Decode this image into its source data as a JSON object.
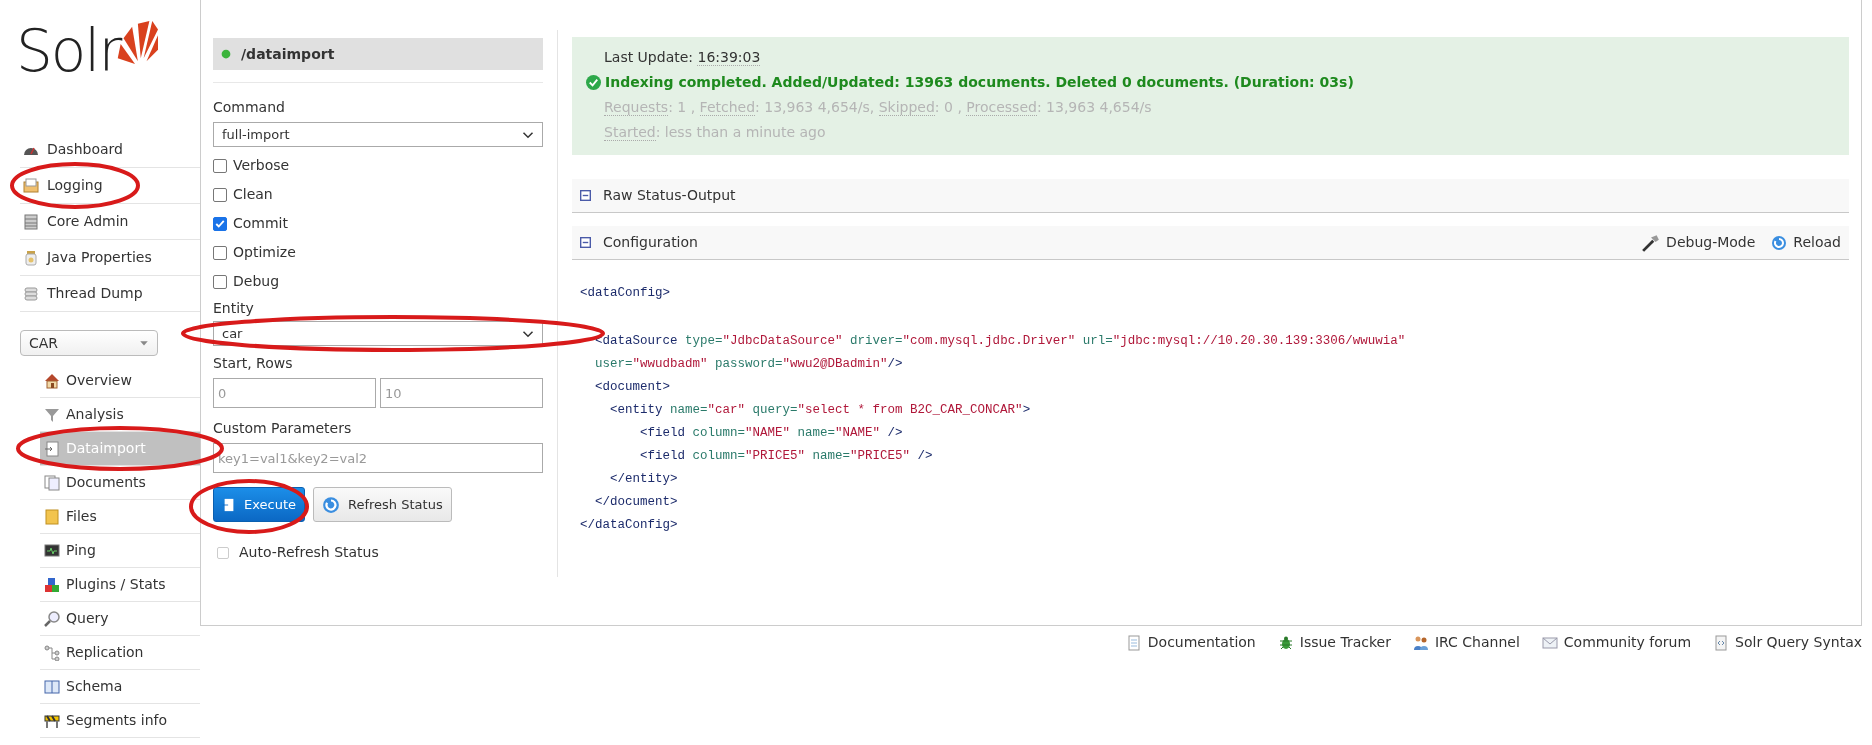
{
  "logo": {
    "text": "Solr"
  },
  "nav": [
    {
      "label": "Dashboard",
      "annotated": false
    },
    {
      "label": "Logging",
      "annotated": true
    },
    {
      "label": "Core Admin",
      "annotated": false
    },
    {
      "label": "Java Properties",
      "annotated": false
    },
    {
      "label": "Thread Dump",
      "annotated": false
    }
  ],
  "core_selector": {
    "value": "CAR"
  },
  "core_nav": [
    {
      "label": "Overview",
      "selected": false,
      "annotated": false
    },
    {
      "label": "Analysis",
      "selected": false,
      "annotated": false
    },
    {
      "label": "Dataimport",
      "selected": true,
      "annotated": true
    },
    {
      "label": "Documents",
      "selected": false,
      "annotated": false
    },
    {
      "label": "Files",
      "selected": false,
      "annotated": false
    },
    {
      "label": "Ping",
      "selected": false,
      "annotated": false
    },
    {
      "label": "Plugins / Stats",
      "selected": false,
      "annotated": false
    },
    {
      "label": "Query",
      "selected": false,
      "annotated": false
    },
    {
      "label": "Replication",
      "selected": false,
      "annotated": false
    },
    {
      "label": "Schema",
      "selected": false,
      "annotated": false
    },
    {
      "label": "Segments info",
      "selected": false,
      "annotated": false
    }
  ],
  "form": {
    "handler": "/dataimport",
    "command_label": "Command",
    "command": "full-import",
    "options": [
      {
        "label": "Verbose",
        "checked": false
      },
      {
        "label": "Clean",
        "checked": false
      },
      {
        "label": "Commit",
        "checked": true
      },
      {
        "label": "Optimize",
        "checked": false
      },
      {
        "label": "Debug",
        "checked": false
      }
    ],
    "entity_label": "Entity",
    "entity": "car",
    "entity_annotated": true,
    "start_rows_label": "Start, Rows",
    "start_placeholder": "0",
    "rows_placeholder": "10",
    "custom_label": "Custom Parameters",
    "custom_placeholder": "key1=val1&key2=val2",
    "buttons": [
      {
        "kind": "primary",
        "label": "Execute",
        "annotated": true
      },
      {
        "kind": "secondary",
        "label": "Refresh Status",
        "annotated": false
      }
    ],
    "auto_refresh": {
      "label": "Auto-Refresh Status",
      "checked": false
    }
  },
  "status": {
    "last_update_label": "Last Update:",
    "last_update": "16:39:03",
    "message": "Indexing completed. Added/Updated: 13963 documents. Deleted 0 documents. (Duration: 03s)",
    "stats": [
      {
        "label": "Requests",
        "value": ": 1 ,"
      },
      {
        "label": "Fetched",
        "value": ": 13,963 4,654/s,"
      },
      {
        "label": "Skipped",
        "value": ": 0 ,"
      },
      {
        "label": "Processed",
        "value": ": 13,963 4,654/s"
      }
    ],
    "started": {
      "label": "Started",
      "value": ": less than a minute ago"
    }
  },
  "sections": [
    {
      "title": "Raw Status-Output"
    },
    {
      "title": "Configuration",
      "actions": [
        {
          "kind": "debug",
          "label": "Debug-Mode"
        },
        {
          "kind": "reload",
          "label": "Reload"
        }
      ]
    }
  ],
  "config_lines": [
    {
      "text": "<dataConfig>"
    },
    {
      "text": "  <dataSource type=\"JdbcDataSource\" driver=\"com.mysql.jdbc.Driver\" url=\"jdbc:mysql://10.20.30.139:3306/wwuwia\"",
      "gap_before": true
    },
    {
      "text": "  user=\"wwudbadm\" password=\"wwu2@DBadmin\"/>"
    },
    {
      "text": "  <document>"
    },
    {
      "text": "    <entity name=\"car\" query=\"select * from B2C_CAR_CONCAR\">"
    },
    {
      "text": "        <field column=\"NAME\" name=\"NAME\" />"
    },
    {
      "text": "        <field column=\"PRICE5\" name=\"PRICE5\" />"
    },
    {
      "text": "    </entity>"
    },
    {
      "text": "  </document>"
    },
    {
      "text": "</dataConfig>"
    }
  ],
  "footer": [
    "Documentation",
    "Issue Tracker",
    "IRC Channel",
    "Community forum",
    "Solr Query Syntax"
  ]
}
